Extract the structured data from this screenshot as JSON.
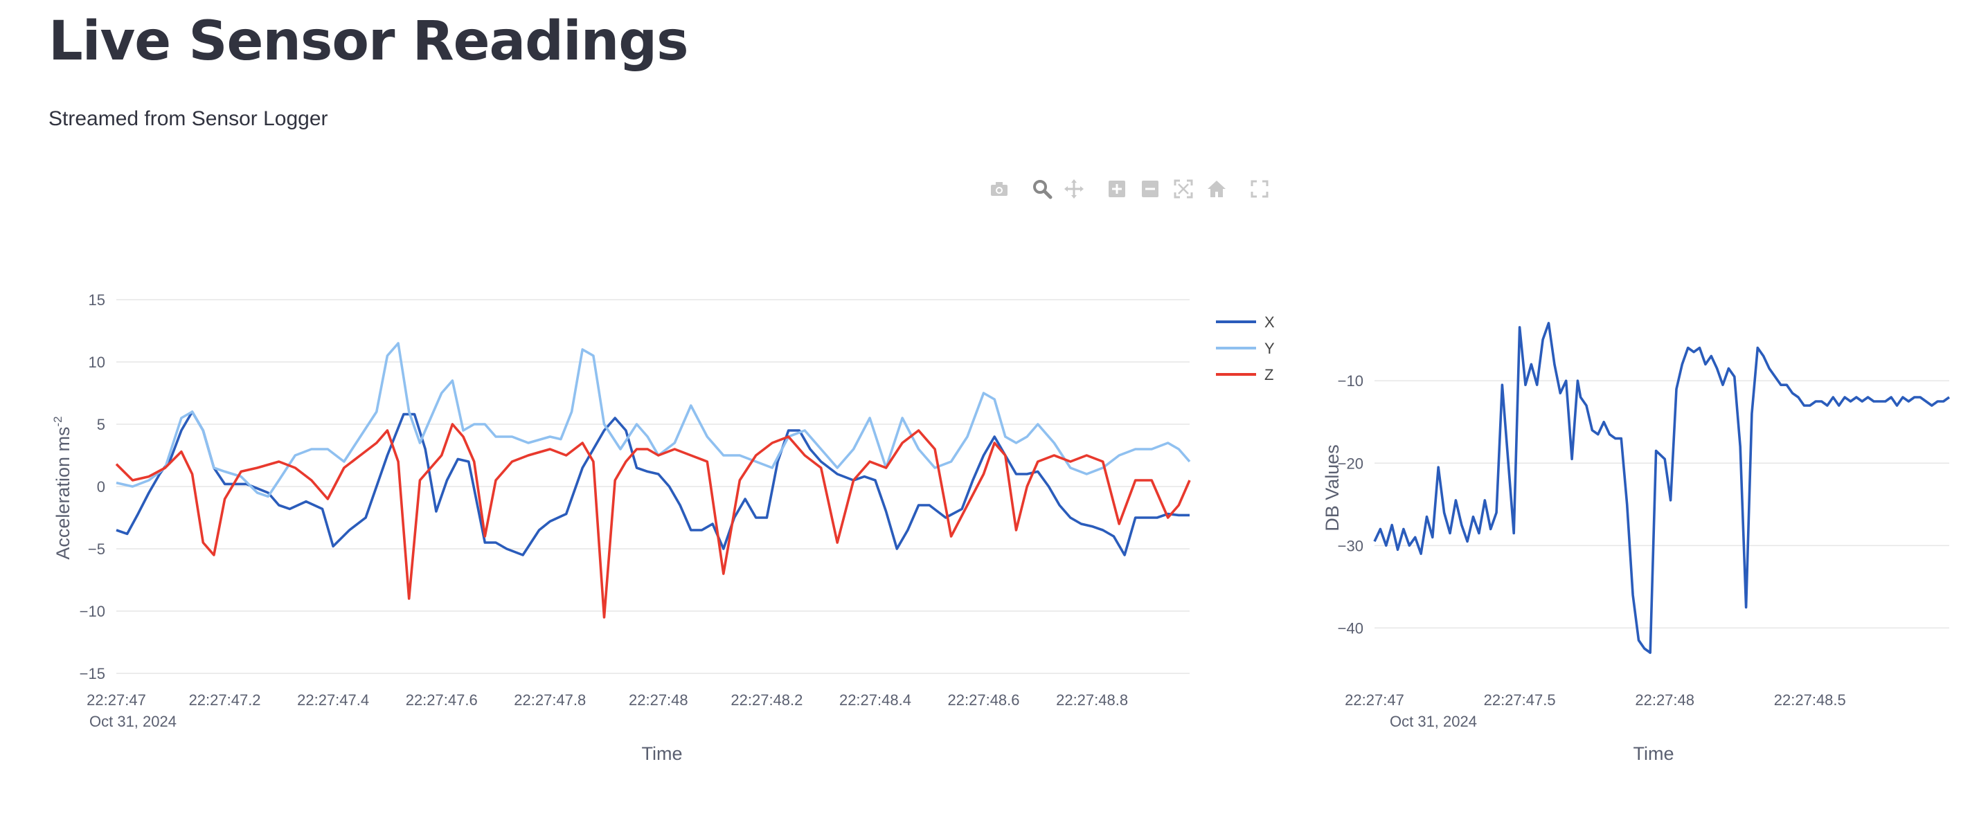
{
  "page": {
    "title": "Live Sensor Readings",
    "subtitle": "Streamed from Sensor Logger"
  },
  "modebar": {
    "buttons": [
      "camera-icon",
      "zoom-icon",
      "pan-icon",
      "zoom-in-icon",
      "zoom-out-icon",
      "autoscale-icon",
      "reset-axes-icon",
      "fullscreen-icon"
    ]
  },
  "colors": {
    "x": "#2a5cbb",
    "y": "#8fc0f0",
    "z": "#e8392d",
    "dB": "#2a5cbb",
    "axis_text": "#5a5f70",
    "grid": "#e6e6e6"
  },
  "chart_data": [
    {
      "type": "line",
      "xlabel": "Time",
      "ylabel": "Acceleration ms",
      "ylabel_sup": "-2",
      "ylim": [
        -15,
        15
      ],
      "yticks": [
        15,
        10,
        5,
        0,
        -5,
        -10,
        -15
      ],
      "ytick_labels": [
        "15",
        "10",
        "5",
        "0",
        "−10",
        "−15"
      ],
      "ytick_labels_all": [
        "15",
        "10",
        "5",
        "0",
        "−5",
        "−10",
        "−15"
      ],
      "xlim": [
        47.0,
        48.98
      ],
      "xticks": [
        47.0,
        47.2,
        47.4,
        47.6,
        47.8,
        48.0,
        48.2,
        48.4,
        48.6,
        48.8
      ],
      "xtick_labels": [
        "22:27:47",
        "22:27:47.2",
        "22:27:47.4",
        "22:27:47.6",
        "22:27:47.8",
        "22:27:48",
        "22:27:48.2",
        "22:27:48.4",
        "22:27:48.6",
        "22:27:48.8"
      ],
      "date_label": "Oct 31, 2024",
      "legend_position": "top-right",
      "series": [
        {
          "name": "X",
          "x": [
            47.0,
            47.02,
            47.04,
            47.06,
            47.08,
            47.1,
            47.12,
            47.14,
            47.16,
            47.18,
            47.2,
            47.24,
            47.28,
            47.3,
            47.32,
            47.35,
            47.38,
            47.4,
            47.43,
            47.46,
            47.5,
            47.53,
            47.55,
            47.57,
            47.59,
            47.61,
            47.63,
            47.65,
            47.68,
            47.7,
            47.72,
            47.75,
            47.78,
            47.8,
            47.83,
            47.86,
            47.88,
            47.9,
            47.92,
            47.94,
            47.96,
            47.98,
            48.0,
            48.02,
            48.04,
            48.06,
            48.08,
            48.1,
            48.12,
            48.14,
            48.16,
            48.18,
            48.2,
            48.22,
            48.24,
            48.26,
            48.28,
            48.3,
            48.33,
            48.36,
            48.38,
            48.4,
            48.42,
            48.44,
            48.46,
            48.48,
            48.5,
            48.53,
            48.56,
            48.58,
            48.6,
            48.62,
            48.64,
            48.66,
            48.68,
            48.7,
            48.72,
            48.74,
            48.76,
            48.78,
            48.8,
            48.82,
            48.84,
            48.86,
            48.88,
            48.9,
            48.92,
            48.94,
            48.96,
            48.98
          ],
          "values": [
            -3.5,
            -3.8,
            -2.2,
            -0.5,
            1.0,
            2.2,
            4.5,
            6.0,
            4.5,
            1.5,
            0.2,
            0.2,
            -0.5,
            -1.5,
            -1.8,
            -1.2,
            -1.8,
            -4.8,
            -3.5,
            -2.5,
            2.5,
            5.8,
            5.8,
            3.0,
            -2.0,
            0.5,
            2.2,
            2.0,
            -4.5,
            -4.5,
            -5.0,
            -5.5,
            -3.5,
            -2.8,
            -2.2,
            1.5,
            3.0,
            4.5,
            5.5,
            4.5,
            1.5,
            1.2,
            1.0,
            0.0,
            -1.5,
            -3.5,
            -3.5,
            -3.0,
            -5.0,
            -2.5,
            -1.0,
            -2.5,
            -2.5,
            2.0,
            4.5,
            4.5,
            3.0,
            2.0,
            1.0,
            0.5,
            0.8,
            0.5,
            -2.0,
            -5.0,
            -3.5,
            -1.5,
            -1.5,
            -2.5,
            -1.8,
            0.5,
            2.5,
            4.0,
            2.5,
            1.0,
            1.0,
            1.2,
            0.0,
            -1.5,
            -2.5,
            -3.0,
            -3.2,
            -3.5,
            -4.0,
            -5.5,
            -2.5,
            -2.5,
            -2.5,
            -2.2,
            -2.3,
            -2.3
          ]
        },
        {
          "name": "Y",
          "x": [
            47.0,
            47.03,
            47.06,
            47.09,
            47.12,
            47.14,
            47.16,
            47.18,
            47.2,
            47.23,
            47.26,
            47.28,
            47.3,
            47.33,
            47.36,
            47.39,
            47.42,
            47.45,
            47.48,
            47.5,
            47.52,
            47.54,
            47.56,
            47.58,
            47.6,
            47.62,
            47.64,
            47.66,
            47.68,
            47.7,
            47.73,
            47.76,
            47.8,
            47.82,
            47.84,
            47.86,
            47.88,
            47.9,
            47.93,
            47.96,
            47.98,
            48.0,
            48.03,
            48.06,
            48.09,
            48.12,
            48.15,
            48.18,
            48.21,
            48.24,
            48.27,
            48.3,
            48.33,
            48.36,
            48.39,
            48.42,
            48.45,
            48.48,
            48.51,
            48.54,
            48.57,
            48.6,
            48.62,
            48.64,
            48.66,
            48.68,
            48.7,
            48.73,
            48.76,
            48.79,
            48.82,
            48.85,
            48.88,
            48.91,
            48.94,
            48.96,
            48.98
          ],
          "values": [
            0.3,
            0.0,
            0.5,
            1.5,
            5.5,
            6.0,
            4.5,
            1.5,
            1.2,
            0.8,
            -0.5,
            -0.8,
            0.5,
            2.5,
            3.0,
            3.0,
            2.0,
            4.0,
            6.0,
            10.5,
            11.5,
            6.0,
            3.5,
            5.5,
            7.5,
            8.5,
            4.5,
            5.0,
            5.0,
            4.0,
            4.0,
            3.5,
            4.0,
            3.8,
            6.0,
            11.0,
            10.5,
            5.0,
            3.0,
            5.0,
            4.0,
            2.5,
            3.5,
            6.5,
            4.0,
            2.5,
            2.5,
            2.0,
            1.5,
            4.0,
            4.5,
            3.0,
            1.5,
            3.0,
            5.5,
            1.5,
            5.5,
            3.0,
            1.5,
            2.0,
            4.0,
            7.5,
            7.0,
            4.0,
            3.5,
            4.0,
            5.0,
            3.5,
            1.5,
            1.0,
            1.5,
            2.5,
            3.0,
            3.0,
            3.5,
            3.0,
            2.0
          ]
        },
        {
          "name": "Z",
          "x": [
            47.0,
            47.03,
            47.06,
            47.09,
            47.12,
            47.14,
            47.16,
            47.18,
            47.2,
            47.23,
            47.26,
            47.3,
            47.33,
            47.36,
            47.39,
            47.42,
            47.45,
            47.48,
            47.5,
            47.52,
            47.54,
            47.56,
            47.58,
            47.6,
            47.62,
            47.64,
            47.66,
            47.68,
            47.7,
            47.73,
            47.76,
            47.8,
            47.83,
            47.86,
            47.88,
            47.9,
            47.92,
            47.94,
            47.96,
            47.98,
            48.0,
            48.03,
            48.06,
            48.09,
            48.12,
            48.15,
            48.18,
            48.21,
            48.24,
            48.27,
            48.3,
            48.33,
            48.36,
            48.39,
            48.42,
            48.45,
            48.48,
            48.51,
            48.54,
            48.57,
            48.6,
            48.62,
            48.64,
            48.66,
            48.68,
            48.7,
            48.73,
            48.76,
            48.79,
            48.82,
            48.85,
            48.88,
            48.91,
            48.94,
            48.96,
            48.98
          ],
          "values": [
            1.8,
            0.5,
            0.8,
            1.5,
            2.8,
            1.0,
            -4.5,
            -5.5,
            -1.0,
            1.2,
            1.5,
            2.0,
            1.5,
            0.5,
            -1.0,
            1.5,
            2.5,
            3.5,
            4.5,
            2.0,
            -9.0,
            0.5,
            1.5,
            2.5,
            5.0,
            4.0,
            2.0,
            -4.0,
            0.5,
            2.0,
            2.5,
            3.0,
            2.5,
            3.5,
            2.0,
            -10.5,
            0.5,
            2.0,
            3.0,
            3.0,
            2.5,
            3.0,
            2.5,
            2.0,
            -7.0,
            0.5,
            2.5,
            3.5,
            4.0,
            2.5,
            1.5,
            -4.5,
            0.5,
            2.0,
            1.5,
            3.5,
            4.5,
            3.0,
            -4.0,
            -1.5,
            1.0,
            3.5,
            2.5,
            -3.5,
            0.0,
            2.0,
            2.5,
            2.0,
            2.5,
            2.0,
            -3.0,
            0.5,
            0.5,
            -2.5,
            -1.5,
            0.5
          ]
        }
      ]
    },
    {
      "type": "line",
      "xlabel": "Time",
      "ylabel": "DB Values",
      "ylim": [
        -44,
        -2
      ],
      "yticks": [
        -10,
        -20,
        -30,
        -40
      ],
      "ytick_labels": [
        "−10",
        "−20",
        "−30",
        "−40"
      ],
      "xlim": [
        47.0,
        48.98
      ],
      "xticks": [
        47.0,
        47.5,
        48.0,
        48.5
      ],
      "xtick_labels": [
        "22:27:47",
        "22:27:47.5",
        "22:27:48",
        "22:27:48.5"
      ],
      "date_label": "Oct 31, 2024",
      "series": [
        {
          "name": "",
          "x": [
            47.0,
            47.02,
            47.04,
            47.06,
            47.08,
            47.1,
            47.12,
            47.14,
            47.16,
            47.18,
            47.2,
            47.22,
            47.24,
            47.26,
            47.28,
            47.3,
            47.32,
            47.34,
            47.36,
            47.38,
            47.4,
            47.42,
            47.44,
            47.46,
            47.48,
            47.5,
            47.52,
            47.54,
            47.56,
            47.58,
            47.6,
            47.62,
            47.64,
            47.66,
            47.68,
            47.7,
            47.71,
            47.73,
            47.75,
            47.77,
            47.79,
            47.81,
            47.83,
            47.85,
            47.87,
            47.89,
            47.91,
            47.93,
            47.95,
            47.97,
            48.0,
            48.02,
            48.04,
            48.06,
            48.08,
            48.1,
            48.12,
            48.14,
            48.16,
            48.18,
            48.2,
            48.22,
            48.24,
            48.26,
            48.28,
            48.3,
            48.32,
            48.34,
            48.36,
            48.38,
            48.4,
            48.42,
            48.44,
            48.46,
            48.48,
            48.5,
            48.52,
            48.54,
            48.56,
            48.58,
            48.6,
            48.62,
            48.64,
            48.66,
            48.68,
            48.7,
            48.72,
            48.74,
            48.76,
            48.78,
            48.8,
            48.82,
            48.84,
            48.86,
            48.88,
            48.9,
            48.92,
            48.94,
            48.96,
            48.98
          ],
          "values": [
            -29.5,
            -28.0,
            -30.0,
            -27.5,
            -30.5,
            -28.0,
            -30.0,
            -29.0,
            -31.0,
            -26.5,
            -29.0,
            -20.5,
            -26.0,
            -28.5,
            -24.5,
            -27.5,
            -29.5,
            -26.5,
            -28.5,
            -24.5,
            -28.0,
            -26.0,
            -10.5,
            -19.5,
            -28.5,
            -3.5,
            -10.5,
            -8.0,
            -10.5,
            -5.0,
            -3.0,
            -8.0,
            -11.5,
            -10.0,
            -19.5,
            -10.0,
            -12.0,
            -13.0,
            -16.0,
            -16.5,
            -15.0,
            -16.5,
            -17.0,
            -17.0,
            -25.0,
            -36.0,
            -41.5,
            -42.5,
            -43.0,
            -18.5,
            -19.5,
            -24.5,
            -11.0,
            -8.0,
            -6.0,
            -6.5,
            -6.0,
            -8.0,
            -7.0,
            -8.5,
            -10.5,
            -8.5,
            -9.5,
            -18.0,
            -37.5,
            -14.0,
            -6.0,
            -7.0,
            -8.5,
            -9.5,
            -10.5,
            -10.5,
            -11.5,
            -12.0,
            -13.0,
            -13.0,
            -12.5,
            -12.5,
            -13.0,
            -12.0,
            -13.0,
            -12.0,
            -12.5,
            -12.0,
            -12.5,
            -12.0,
            -12.5,
            -12.5,
            -12.5,
            -12.0,
            -13.0,
            -12.0,
            -12.5,
            -12.0,
            -12.0,
            -12.5,
            -13.0,
            -12.5,
            -12.5,
            -12.0
          ]
        }
      ]
    }
  ]
}
